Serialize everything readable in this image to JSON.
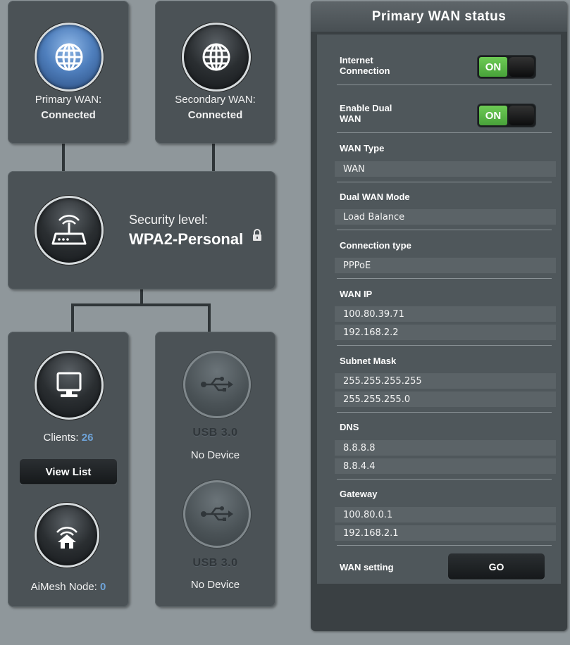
{
  "network": {
    "primary_wan": {
      "label": "Primary WAN:",
      "status": "Connected"
    },
    "secondary_wan": {
      "label": "Secondary WAN:",
      "status": "Connected"
    },
    "router": {
      "security_label": "Security level:",
      "security_value": "WPA2-Personal"
    },
    "clients": {
      "label": "Clients:",
      "count": "26",
      "button": "View List"
    },
    "aimesh": {
      "label": "AiMesh Node:",
      "count": "0"
    },
    "usb1": {
      "title": "USB 3.0",
      "status": "No Device"
    },
    "usb2": {
      "title": "USB 3.0",
      "status": "No Device"
    }
  },
  "status_panel": {
    "title": "Primary WAN status",
    "internet_connection": {
      "label_line1": "Internet",
      "label_line2": "Connection",
      "toggle": "ON"
    },
    "enable_dual_wan": {
      "label_line1": "Enable Dual",
      "label_line2": "WAN",
      "toggle": "ON"
    },
    "wan_type": {
      "label": "WAN Type",
      "value": "WAN"
    },
    "dual_wan_mode": {
      "label": "Dual WAN Mode",
      "value": "Load Balance"
    },
    "connection_type": {
      "label": "Connection type",
      "value": "PPPoE"
    },
    "wan_ip": {
      "label": "WAN IP",
      "values": [
        "100.80.39.71",
        "192.168.2.2"
      ]
    },
    "subnet_mask": {
      "label": "Subnet Mask",
      "values": [
        "255.255.255.255",
        "255.255.255.0"
      ]
    },
    "dns": {
      "label": "DNS",
      "values": [
        "8.8.8.8",
        "8.8.4.4"
      ]
    },
    "gateway": {
      "label": "Gateway",
      "values": [
        "100.80.0.1",
        "192.168.2.1"
      ]
    },
    "wan_setting": {
      "label": "WAN setting",
      "button": "GO"
    }
  },
  "colors": {
    "accent": "#6ea3d8",
    "toggle_on": "#5bb547",
    "panel": "#4b5256",
    "background": "#8f979b"
  }
}
